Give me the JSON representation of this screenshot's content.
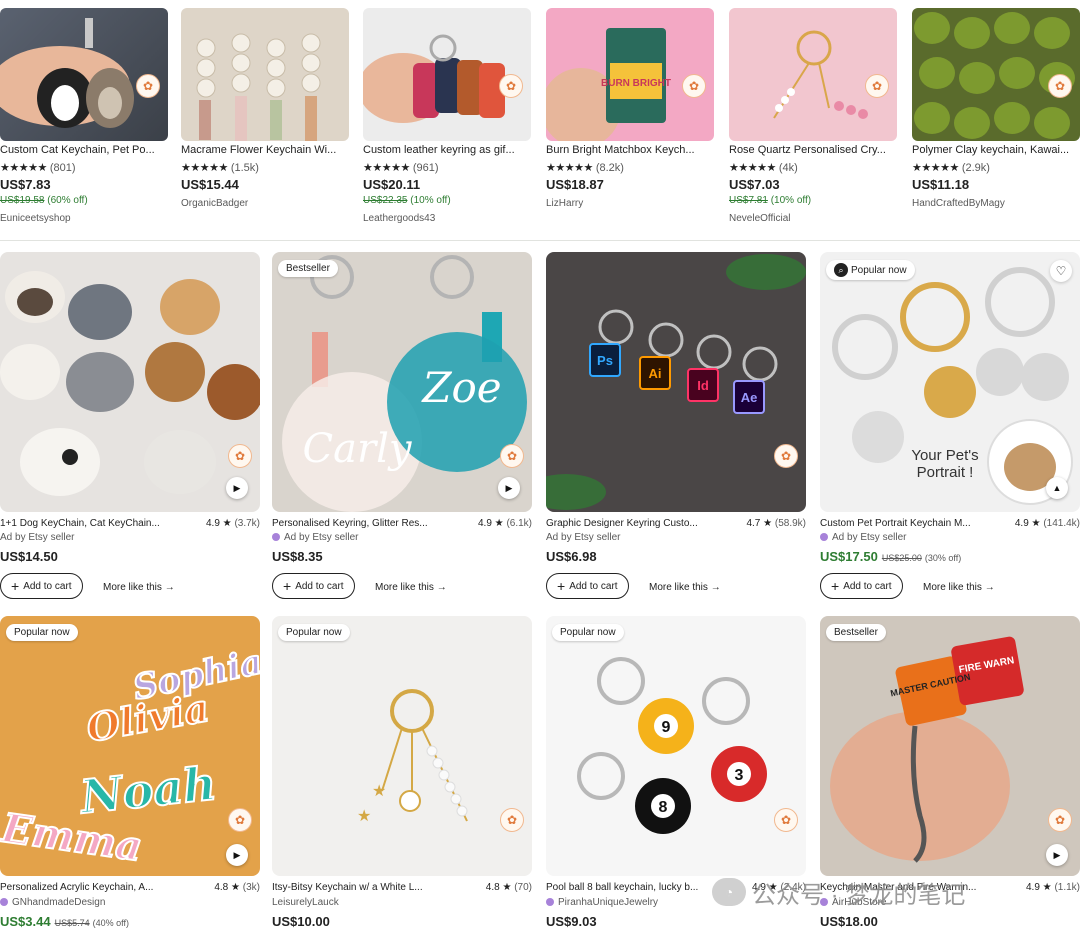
{
  "colors": {
    "accent_sale": "#2e7d32",
    "bee_badge": "#e07a3c",
    "ad_dot": "#a782d9"
  },
  "icons": {
    "bee": "etsy-bee-icon",
    "play": "play-icon",
    "plus": "plus-icon",
    "arrow": "arrow-right-icon",
    "heart": "heart-icon",
    "star": "star-icon"
  },
  "top_row": [
    {
      "title": "Custom Cat Keychain, Pet Po...",
      "stars": "★★★★★",
      "count": "(801)",
      "price": "US$7.83",
      "orig": "US$19.58",
      "off": "(60% off)",
      "shop": "Euniceetsyshop"
    },
    {
      "title": "Macrame Flower Keychain Wi...",
      "stars": "★★★★★",
      "count": "(1.5k)",
      "price": "US$15.44",
      "orig": "",
      "off": "",
      "shop": "OrganicBadger"
    },
    {
      "title": "Custom leather keyring as gif...",
      "stars": "★★★★★",
      "count": "(961)",
      "price": "US$20.11",
      "orig": "US$22.35",
      "off": "(10% off)",
      "shop": "Leathergoods43"
    },
    {
      "title": "Burn Bright Matchbox Keych...",
      "stars": "★★★★★",
      "count": "(8.2k)",
      "price": "US$18.87",
      "orig": "",
      "off": "",
      "shop": "LizHarry"
    },
    {
      "title": "Rose Quartz Personalised Cry...",
      "stars": "★★★★★",
      "count": "(4k)",
      "price": "US$7.03",
      "orig": "US$7.81",
      "off": "(10% off)",
      "shop": "NeveleOfficial"
    },
    {
      "title": "Polymer Clay keychain, Kawai...",
      "stars": "★★★★★",
      "count": "(2.9k)",
      "price": "US$11.18",
      "orig": "",
      "off": "",
      "shop": "HandCraftedByMagy"
    }
  ],
  "grid": [
    {
      "badge": "",
      "title": "1+1 Dog KeyChain, Cat KeyChain...",
      "rating": "4.9 ★",
      "count": "(3.7k)",
      "ad": "Ad by Etsy seller",
      "price": "US$14.50",
      "orig": "",
      "off": "",
      "add": "Add to cart",
      "more": "More like this"
    },
    {
      "badge": "Bestseller",
      "title": "Personalised Keyring, Glitter Res...",
      "rating": "4.9 ★",
      "count": "(6.1k)",
      "ad": "Ad by Etsy seller",
      "price": "US$8.35",
      "orig": "",
      "off": "",
      "add": "Add to cart",
      "more": "More like this"
    },
    {
      "badge": "",
      "title": "Graphic Designer Keyring Custo...",
      "rating": "4.7 ★",
      "count": "(58.9k)",
      "ad": "Ad by Etsy seller",
      "price": "US$6.98",
      "orig": "",
      "off": "",
      "add": "Add to cart",
      "more": "More like this"
    },
    {
      "badge": "Popular now",
      "title": "Custom Pet Portrait Keychain M...",
      "rating": "4.9 ★",
      "count": "(141.4k)",
      "ad": "Ad by Etsy seller",
      "price": "US$17.50",
      "orig": "US$25.00",
      "off": "(30% off)",
      "add": "Add to cart",
      "more": "More like this"
    },
    {
      "badge": "Popular now",
      "title": "Personalized Acrylic Keychain, A...",
      "rating": "4.8 ★",
      "count": "(3k)",
      "ad": "GNhandmadeDesign",
      "price": "US$3.44",
      "orig": "US$5.74",
      "off": "(40% off)"
    },
    {
      "badge": "Popular now",
      "title": "Itsy-Bitsy Keychain w/ a White L...",
      "rating": "4.8 ★",
      "count": "(70)",
      "ad": "LeisurelyLauck",
      "price": "US$10.00",
      "orig": "",
      "off": ""
    },
    {
      "badge": "Popular now",
      "title": "Pool ball 8 ball keychain, lucky b...",
      "rating": "4.9 ★",
      "count": "(2.4k)",
      "ad": "PiranhaUniqueJewelry",
      "price": "US$9.03",
      "orig": "",
      "off": ""
    },
    {
      "badge": "Bestseller",
      "title": "Keychain Master and Fire Warnin...",
      "rating": "4.9 ★",
      "count": "(1.1k)",
      "ad": "AirHubStore",
      "price": "US$18.00",
      "orig": "",
      "off": ""
    }
  ],
  "image_text": {
    "matchbox": "BURN BRIGHT",
    "ps": "Ps",
    "ai": "Ai",
    "id": "Id",
    "ae": "Ae",
    "portrait": "Your Pet's Portrait !",
    "names": [
      "Sophia",
      "Olivia",
      "Noah",
      "Emma"
    ],
    "cube1": "MASTER CAUTION",
    "cube2": "FIRE WARN"
  },
  "watermark": "公众号 · 梦龙的笔记"
}
